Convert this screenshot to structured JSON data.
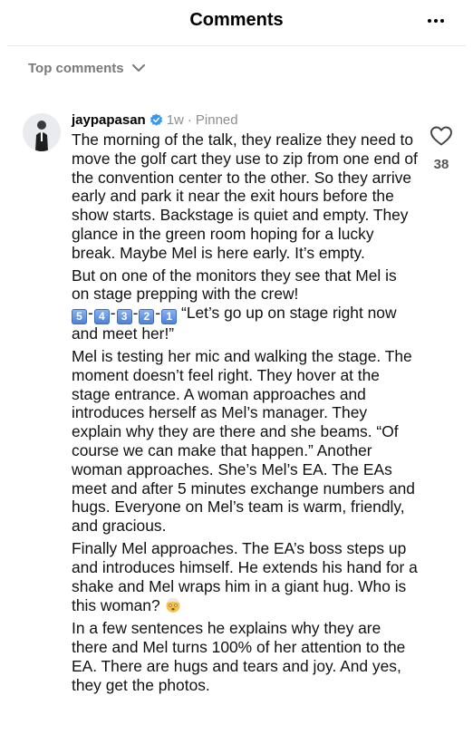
{
  "header": {
    "title": "Comments",
    "more_icon": "more-horizontal-icon"
  },
  "sort": {
    "label": "Top comments",
    "icon": "chevron-down-icon"
  },
  "comment": {
    "username": "jaypapasan",
    "verified": true,
    "timestamp": "1w",
    "separator": "·",
    "pinned": "Pinned",
    "like_count": "38",
    "like_icon": "heart-icon",
    "p1": "The morning of the talk, they realize they need to move the golf cart they use to zip from one end of the convention center to the other. So they arrive early and park it near the exit hours before the show starts. Backstage is quiet and empty. They glance in the green room hoping for a lucky break. Maybe Mel is here early. It’s empty.",
    "p2_intro": "But on one of the monitors they see that Mel is on stage prepping with the crew!",
    "countdown": [
      "5",
      "4",
      "3",
      "2",
      "1"
    ],
    "countdown_sep": "-",
    "p2_quote": "“Let’s go up on stage right now and meet her!”",
    "p3": "Mel is testing her mic and walking the stage. The moment doesn’t feel right. They hover at the stage entrance. A woman approaches and introduces herself as Mel’s manager. They explain why they are there and she beams. “Of course we can make that happen.” Another woman approaches. She’s Mel’s EA. The EAs meet and after 5 minutes exchange numbers and hugs. Everyone on Mel’s team is warm, friendly, and gracious.",
    "p4": "Finally Mel approaches. The EA’s boss steps up and introduces himself. He extends his hand for a shake and Mel wraps him in a giant hug. Who is this woman?",
    "p4_emoji": "exploding-head-emoji",
    "p5": "In a few sentences he explains why they are there and Mel turns 100% of her attention to the EA. There are hugs and tears and joy. And yes, they get the photos."
  },
  "colors": {
    "verified_blue": "#3897f0",
    "muted_text": "#8e8e8e"
  }
}
